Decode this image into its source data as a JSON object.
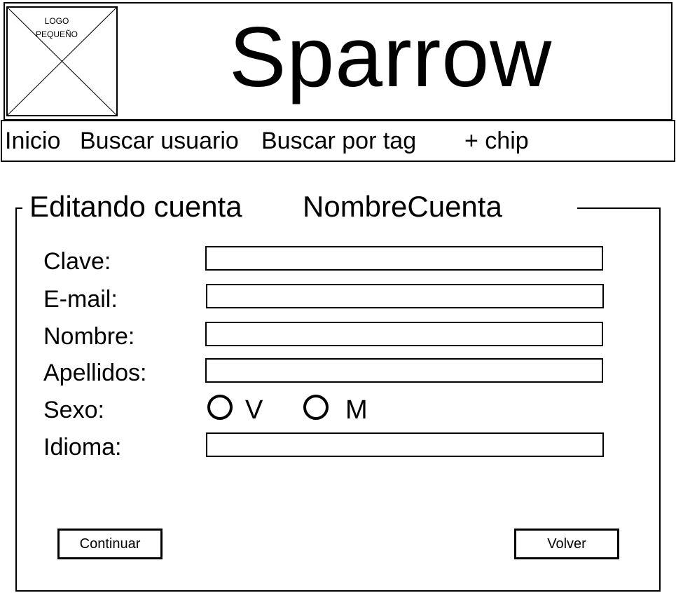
{
  "header": {
    "logo_line1": "LOGO",
    "logo_line2": "PEQUEÑO",
    "app_title": "Sparrow"
  },
  "nav": {
    "items": [
      "Inicio",
      "Buscar usuario",
      "Buscar por tag",
      "+ chip"
    ]
  },
  "panel": {
    "title": "Editando cuenta",
    "account_name": "NombreCuenta"
  },
  "form": {
    "clave_label": "Clave:",
    "email_label": "E-mail:",
    "nombre_label": "Nombre:",
    "apellidos_label": "Apellidos:",
    "sexo_label": "Sexo:",
    "sexo_options": [
      "V",
      "M"
    ],
    "idioma_label": "Idioma:",
    "clave_value": "",
    "email_value": "",
    "nombre_value": "",
    "apellidos_value": "",
    "idioma_value": ""
  },
  "buttons": {
    "continuar": "Continuar",
    "volver": "Volver"
  }
}
